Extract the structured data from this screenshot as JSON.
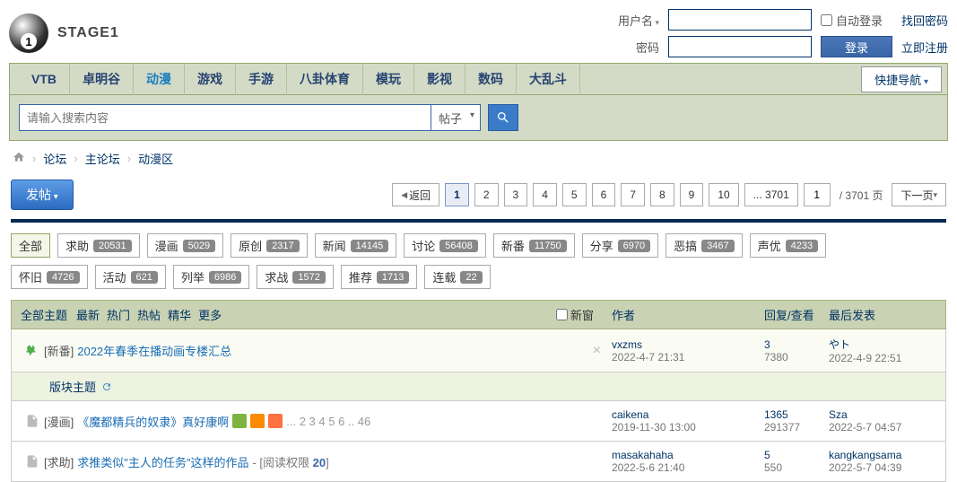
{
  "logo_text": "STAGE1",
  "login": {
    "user_label": "用户名",
    "pass_label": "密码",
    "auto_label": "自动登录",
    "find_pwd": "找回密码",
    "register": "立即注册",
    "login_btn": "登录"
  },
  "nav": {
    "items": [
      "VTB",
      "卓明谷",
      "动漫",
      "游戏",
      "手游",
      "八卦体育",
      "模玩",
      "影视",
      "数码",
      "大乱斗"
    ],
    "active_index": 2,
    "quick": "快捷导航"
  },
  "search": {
    "placeholder": "请输入搜索内容",
    "type": "帖子"
  },
  "breadcrumb": {
    "items": [
      "论坛",
      "主论坛",
      "动漫区"
    ]
  },
  "post_btn": "发帖",
  "pagination": {
    "back": "返回",
    "pages": [
      "1",
      "2",
      "3",
      "4",
      "5",
      "6",
      "7",
      "8",
      "9",
      "10",
      "... 3701"
    ],
    "current": "1",
    "input": "1",
    "total": "/ 3701 页",
    "next": "下一页"
  },
  "tags_row1": [
    {
      "name": "全部",
      "count": null,
      "active": true
    },
    {
      "name": "求助",
      "count": "20531"
    },
    {
      "name": "漫画",
      "count": "5029"
    },
    {
      "name": "原创",
      "count": "2317"
    },
    {
      "name": "新闻",
      "count": "14145"
    },
    {
      "name": "讨论",
      "count": "56408"
    },
    {
      "name": "新番",
      "count": "11750"
    },
    {
      "name": "分享",
      "count": "6970"
    },
    {
      "name": "恶搞",
      "count": "3467"
    },
    {
      "name": "声优",
      "count": "4233"
    }
  ],
  "tags_row2": [
    {
      "name": "怀旧",
      "count": "4726"
    },
    {
      "name": "活动",
      "count": "621"
    },
    {
      "name": "列举",
      "count": "6986"
    },
    {
      "name": "求战",
      "count": "1572"
    },
    {
      "name": "推荐",
      "count": "1713"
    },
    {
      "name": "连载",
      "count": "22"
    }
  ],
  "thread_header": {
    "all": "全部主题",
    "sorts": [
      "最新",
      "热门",
      "热帖",
      "精华",
      "更多"
    ],
    "newwin": "新窗",
    "author": "作者",
    "reply": "回复/查看",
    "last": "最后发表"
  },
  "section_title": "版块主题",
  "threads": [
    {
      "pinned": true,
      "icon": "pin",
      "cat": "[新番]",
      "title": "2022年春季在播动画专楼汇总",
      "badges": [],
      "pages": null,
      "closable": true,
      "author": "vxzms",
      "date": "2022-4-7 21:31",
      "replies": "3",
      "views": "7380",
      "last_user": "やト",
      "last_date": "2022-4-9 22:51"
    },
    {
      "pinned": false,
      "icon": "doc",
      "cat": "[漫画]",
      "title": "《魔都精兵的奴隶》真好康啊",
      "badges": [
        "green",
        "orange",
        "orange2"
      ],
      "pages": "... 2  3  4  5  6 .. 46",
      "closable": false,
      "author": "caikena",
      "date": "2019-11-30 13:00",
      "replies": "1365",
      "views": "291377",
      "last_user": "Sza",
      "last_date": "2022-5-7 04:57"
    },
    {
      "pinned": false,
      "icon": "doc",
      "cat": "[求助]",
      "title": "求推类似\"主人的任务\"这样的作品",
      "perm_label": "阅读权限",
      "perm_value": "20",
      "badges": [],
      "pages": null,
      "closable": false,
      "author": "masakahaha",
      "date": "2022-5-6 21:40",
      "replies": "5",
      "views": "550",
      "last_user": "kangkangsama",
      "last_date": "2022-5-7 04:39"
    }
  ]
}
